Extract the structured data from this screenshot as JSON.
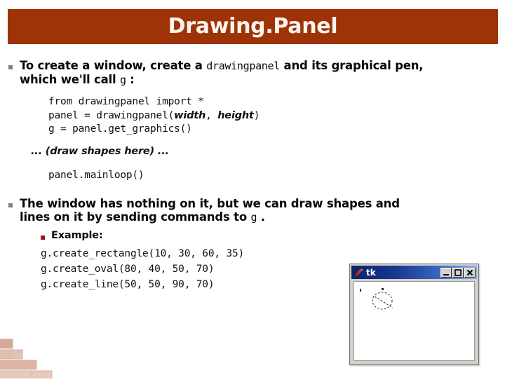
{
  "slide": {
    "title": "Drawing.Panel",
    "banner_color": "#9E3307",
    "bullets": [
      {
        "level": 1,
        "marker_color": "#808080",
        "line1_a": "To create a window, create a ",
        "line1_code": "drawingpanel",
        "line1_b": " and its graphical pen,",
        "line2_a": "which we'll call ",
        "line2_code": "g",
        "line2_b": " :"
      },
      {
        "level": 1,
        "marker_color": "#808080",
        "line1": "The window has nothing on it, but we can draw shapes and",
        "line2_a": "lines on it by sending commands to ",
        "line2_code": "g",
        "line2_b": " ."
      }
    ],
    "sub_bullet": {
      "level": 2,
      "marker_color": "#8C1A14",
      "label": "Example:"
    },
    "code_create": {
      "line1": "from drawingpanel import *",
      "line2_a": "panel = drawingpanel(",
      "line2_emph1": "width",
      "line2_mid": ", ",
      "line2_emph2": "height",
      "line2_b": ")",
      "line3": "g = panel.get_graphics()"
    },
    "draw_shapes_note": "... (draw shapes here) ...",
    "code_mainloop": "panel.mainloop()",
    "code_example": {
      "line1": "g.create_rectangle(10, 30, 60, 35)",
      "line2": "g.create_oval(80, 40, 50, 70)",
      "line3": "g.create_line(50, 50, 90, 70)"
    }
  },
  "tk_window": {
    "title": "tk",
    "icon_name": "tk-feather-icon",
    "titlebar_color_start": "#0A246A",
    "titlebar_color_end": "#8CB0E8",
    "buttons": [
      {
        "name": "minimize-button",
        "label": "_"
      },
      {
        "name": "maximize-button",
        "label": "□"
      },
      {
        "name": "close-button",
        "label": "✕"
      }
    ],
    "canvas_background": "#FFFFFF"
  }
}
